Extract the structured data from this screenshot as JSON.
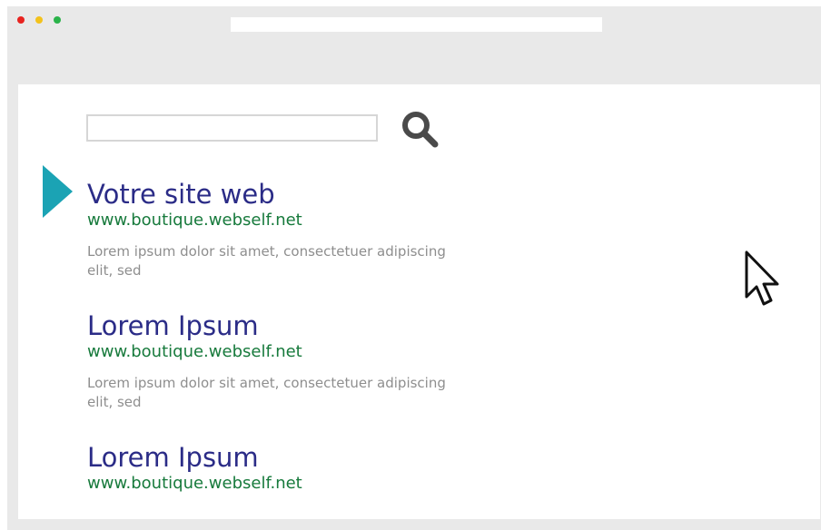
{
  "window": {
    "controls": {
      "close_color": "#e8231f",
      "minimize_color": "#f3c21c",
      "maximize_color": "#2bb34a"
    },
    "address_bar": {
      "value": ""
    }
  },
  "search": {
    "value": "",
    "placeholder": "",
    "button_icon": "magnifier-icon"
  },
  "results": [
    {
      "title": "Votre site web",
      "url": "www.boutique.webself.net",
      "description": "Lorem ipsum dolor sit amet, consectetuer adipiscing elit, sed",
      "highlighted": true
    },
    {
      "title": "Lorem Ipsum",
      "url": "www.boutique.webself.net",
      "description": "Lorem ipsum dolor sit amet, consectetuer adipiscing elit, sed",
      "highlighted": false
    },
    {
      "title": "Lorem Ipsum",
      "url": "www.boutique.webself.net",
      "highlighted": false
    }
  ],
  "colors": {
    "title": "#2b2c87",
    "url": "#177a3c",
    "description": "#8e8e8e",
    "highlight_arrow": "#1ba3b4",
    "window_chrome": "#e9e9e9"
  },
  "pointer": {
    "icon": "mouse-pointer-icon"
  }
}
